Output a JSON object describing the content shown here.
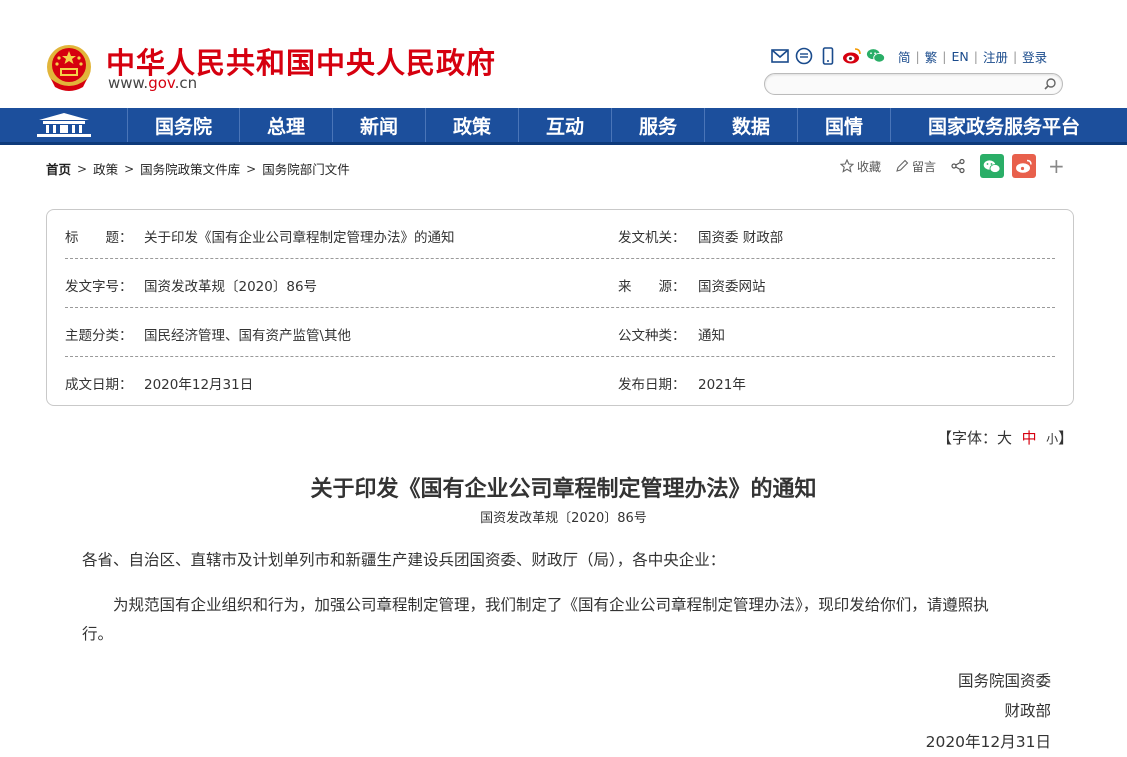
{
  "header": {
    "site_title": "中华人民共和国中央人民政府",
    "site_url_prefix": "www.",
    "site_url_brand": "gov",
    "site_url_suffix": ".cn",
    "lang_links": [
      "简",
      "繁",
      "EN",
      "注册",
      "登录"
    ],
    "search_placeholder": ""
  },
  "nav": {
    "items": [
      "国务院",
      "总理",
      "新闻",
      "政策",
      "互动",
      "服务",
      "数据",
      "国情",
      "国家政务服务平台"
    ]
  },
  "breadcrumb": {
    "items": [
      "首页",
      "政策",
      "国务院政策文件库",
      "国务院部门文件"
    ]
  },
  "share": {
    "favorite": "收藏",
    "comment": "留言"
  },
  "info": {
    "title_label": "标　　题：",
    "title_value": "关于印发《国有企业公司章程制定管理办法》的通知",
    "issuer_label": "发文机关：",
    "issuer_value": "国资委 财政部",
    "docno_label": "发文字号：",
    "docno_value": "国资发改革规〔2020〕86号",
    "source_label": "来　　源：",
    "source_value": "国资委网站",
    "topic_label": "主题分类：",
    "topic_value": "国民经济管理、国有资产监管\\其他",
    "type_label": "公文种类：",
    "type_value": "通知",
    "written_label": "成文日期：",
    "written_value": "2020年12月31日",
    "published_label": "发布日期：",
    "published_value": "2021年"
  },
  "fontsize": {
    "prefix": "【字体：",
    "large": "大",
    "medium": "中",
    "small": "小",
    "suffix": "】"
  },
  "article": {
    "title": "关于印发《国有企业公司章程制定管理办法》的通知",
    "doc_number": "国资发改革规〔2020〕86号",
    "salutation": "各省、自治区、直辖市及计划单列市和新疆生产建设兵团国资委、财政厅（局），各中央企业：",
    "body_line1": "　　为规范国有企业组织和行为，加强公司章程制定管理，我们制定了《国有企业公司章程制定管理办法》，现印发给你们，请遵照执",
    "body_line2": "行。",
    "sign1": "国务院国资委",
    "sign2": "财政部",
    "sign_date": "2020年12月31日"
  },
  "colors": {
    "brand_red": "#d6000f",
    "nav_blue": "#1c4f9c",
    "wechat_green": "#2aae67",
    "weibo_red": "#e8604c"
  }
}
